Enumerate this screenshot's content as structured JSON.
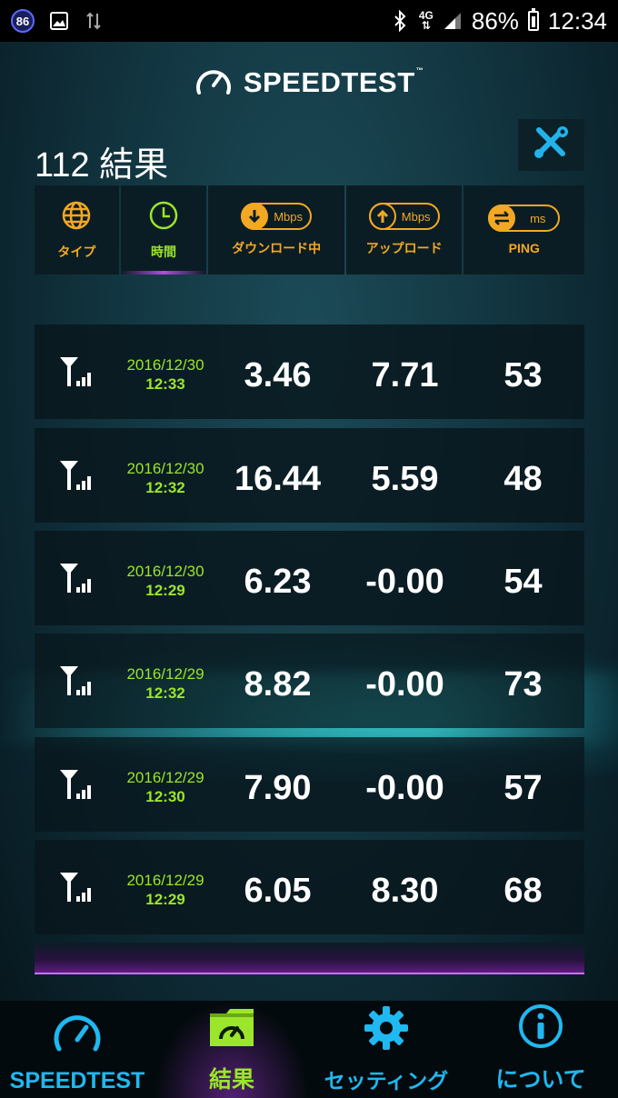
{
  "status_bar": {
    "notification_count": "86",
    "network": "4G",
    "battery": "86%",
    "time": "12:34"
  },
  "header": {
    "brand": "SPEEDTEST",
    "trademark": "™",
    "title": "112 結果"
  },
  "sort_bar": {
    "items": [
      {
        "label": "タイプ",
        "icon": "globe-icon"
      },
      {
        "label": "時間",
        "icon": "clock-icon",
        "active": true
      },
      {
        "label": "ダウンロード中",
        "unit": "Mbps",
        "icon": "download-icon"
      },
      {
        "label": "アップロード",
        "unit": "Mbps",
        "icon": "upload-icon"
      },
      {
        "label": "PING",
        "unit": "ms",
        "icon": "ping-icon"
      }
    ]
  },
  "results": [
    {
      "connection": "cellular-signal-icon",
      "date": "2016/12/30",
      "time": "12:33",
      "download": "3.46",
      "upload": "7.71",
      "ping": "53"
    },
    {
      "connection": "cellular-signal-icon",
      "date": "2016/12/30",
      "time": "12:32",
      "download": "16.44",
      "upload": "5.59",
      "ping": "48"
    },
    {
      "connection": "cellular-signal-icon",
      "date": "2016/12/30",
      "time": "12:29",
      "download": "6.23",
      "upload": "-0.00",
      "ping": "54"
    },
    {
      "connection": "cellular-signal-icon",
      "date": "2016/12/29",
      "time": "12:32",
      "download": "8.82",
      "upload": "-0.00",
      "ping": "73"
    },
    {
      "connection": "cellular-signal-icon",
      "date": "2016/12/29",
      "time": "12:30",
      "download": "7.90",
      "upload": "-0.00",
      "ping": "57"
    },
    {
      "connection": "cellular-signal-icon",
      "date": "2016/12/29",
      "time": "12:29",
      "download": "6.05",
      "upload": "8.30",
      "ping": "68"
    }
  ],
  "bottom_nav": [
    {
      "label": "SPEEDTEST",
      "icon": "gauge-icon"
    },
    {
      "label": "結果",
      "icon": "results-folder-icon",
      "active": true
    },
    {
      "label": "セッティング",
      "icon": "gear-icon"
    },
    {
      "label": "について",
      "icon": "info-icon"
    }
  ],
  "colors": {
    "accent_orange": "#f3a823",
    "accent_green": "#9be52a",
    "accent_blue": "#20b8f0",
    "accent_purple": "#b548e0"
  }
}
